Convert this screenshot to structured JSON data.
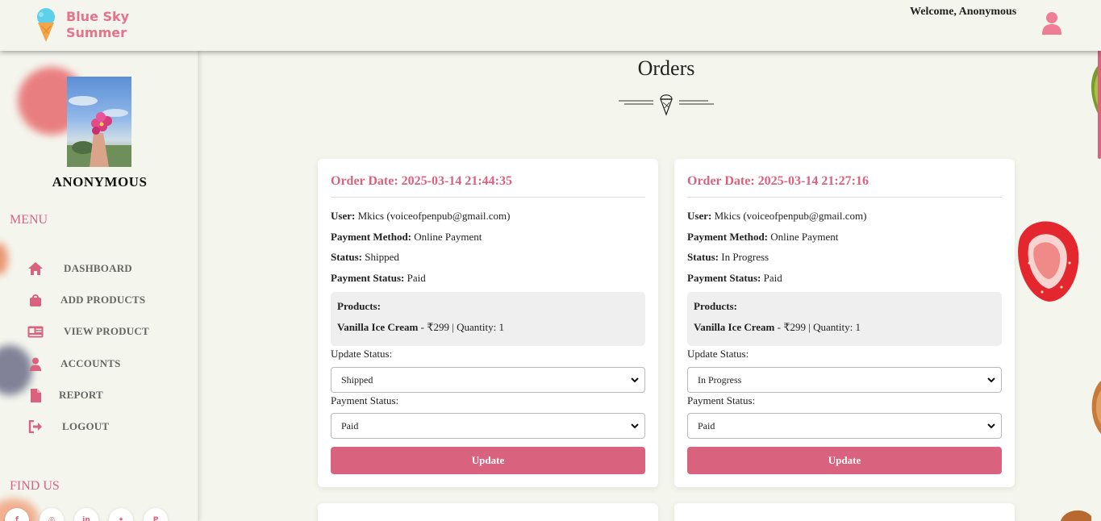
{
  "brand": {
    "name_line1": "Blue Sky",
    "name_line2": "Summer"
  },
  "header": {
    "welcome": "Welcome, Anonymous"
  },
  "sidebar": {
    "profile_name": "ANONYMOUS",
    "menu_title": "MENU",
    "items": [
      {
        "label": "DASHBOARD",
        "icon": "home-icon"
      },
      {
        "label": "ADD PRODUCTS",
        "icon": "shopping-bag-icon"
      },
      {
        "label": "VIEW PRODUCT",
        "icon": "id-card-icon"
      },
      {
        "label": "ACCOUNTS",
        "icon": "user-icon"
      },
      {
        "label": "REPORT",
        "icon": "file-icon"
      },
      {
        "label": "LOGOUT",
        "icon": "logout-icon"
      }
    ],
    "findus_title": "FIND US",
    "social": [
      {
        "icon": "facebook-icon",
        "glyph": "f"
      },
      {
        "icon": "instagram-icon",
        "glyph": "◎"
      },
      {
        "icon": "linkedin-icon",
        "glyph": "in"
      },
      {
        "icon": "twitter-icon",
        "glyph": "✦"
      },
      {
        "icon": "pinterest-icon",
        "glyph": "P"
      }
    ]
  },
  "page": {
    "title": "Orders"
  },
  "colors": {
    "accent": "#d9627e",
    "background": "#f4f6ee",
    "card": "#ffffff",
    "products_box": "#efefef"
  },
  "labels": {
    "user": "User:",
    "payment_method": "Payment Method:",
    "status": "Status:",
    "payment_status": "Payment Status:",
    "products": "Products:",
    "update_status": "Update Status:",
    "payment_status_ctrl": "Payment Status:",
    "update_button": "Update"
  },
  "orders": [
    {
      "order_date": "Order Date: 2025-03-14 21:44:35",
      "user": "Mkics (voiceofpenpub@gmail.com)",
      "payment_method": "Online Payment",
      "status": "Shipped",
      "payment_status": "Paid",
      "product_name": "Vanilla Ice Cream",
      "product_detail": " - ₹299 | Quantity: 1",
      "status_select": "Shipped",
      "payment_select": "Paid"
    },
    {
      "order_date": "Order Date: 2025-03-14 21:27:16",
      "user": "Mkics (voiceofpenpub@gmail.com)",
      "payment_method": "Online Payment",
      "status": "In Progress",
      "payment_status": "Paid",
      "product_name": "Vanilla Ice Cream",
      "product_detail": " - ₹299 | Quantity: 1",
      "status_select": "In Progress",
      "payment_select": "Paid"
    }
  ]
}
